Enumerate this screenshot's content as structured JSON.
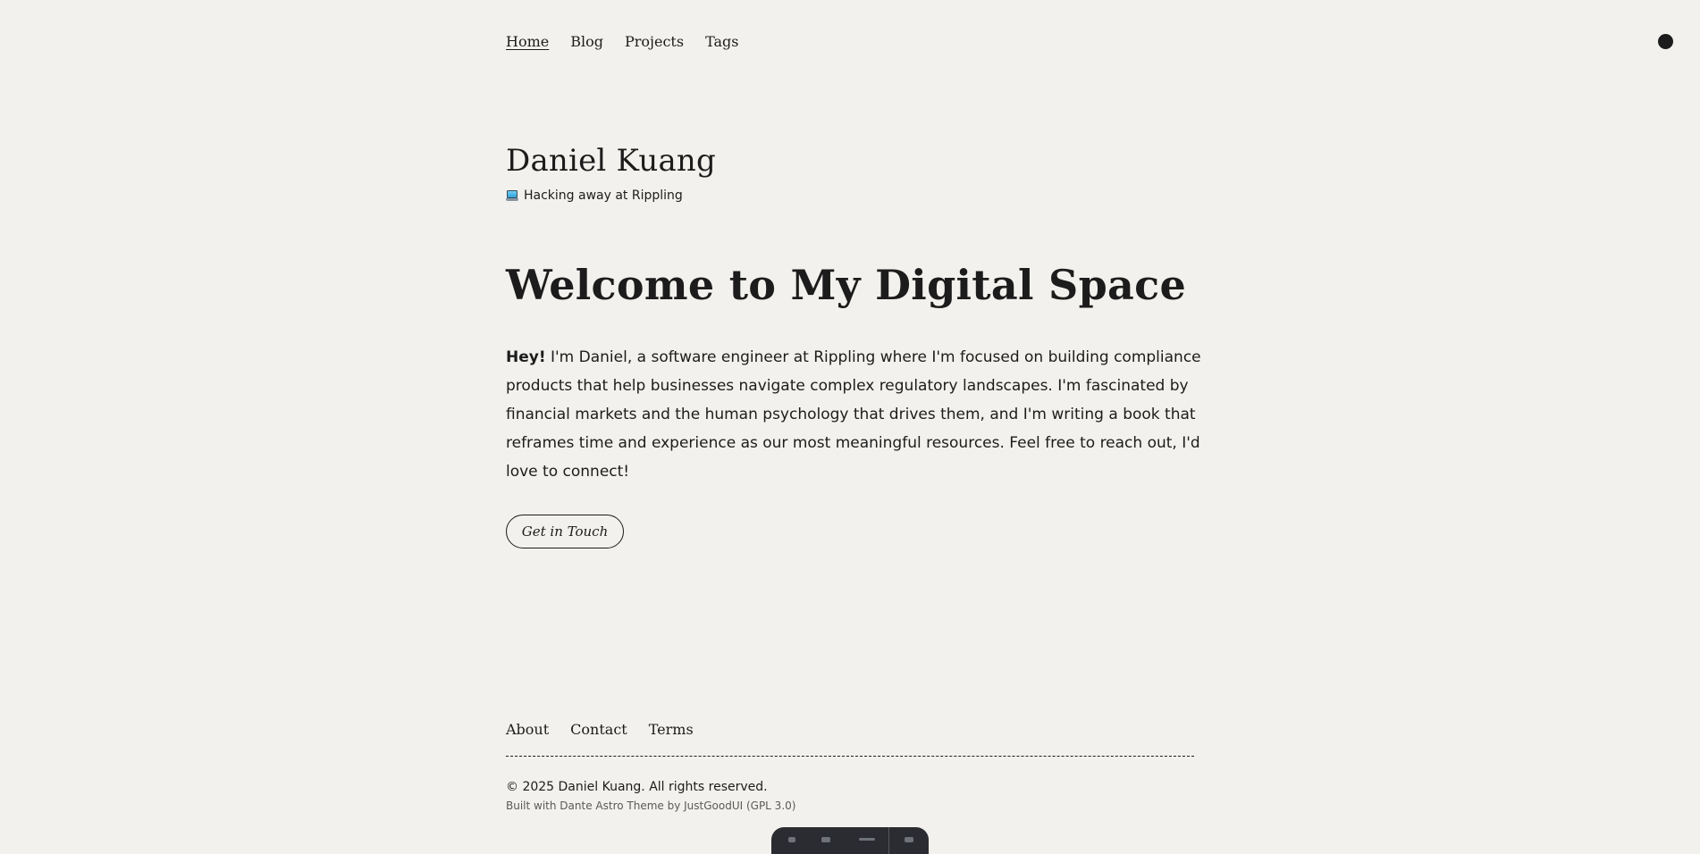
{
  "nav": {
    "items": [
      {
        "label": "Home",
        "active": true
      },
      {
        "label": "Blog",
        "active": false
      },
      {
        "label": "Projects",
        "active": false
      },
      {
        "label": "Tags",
        "active": false
      }
    ],
    "theme_toggle_icon": "dark-mode-dot-icon"
  },
  "header": {
    "site_name": "Daniel Kuang",
    "tagline_icon": "laptop-icon",
    "tagline": "Hacking away at Rippling"
  },
  "hero": {
    "title": "Welcome to My Digital Space",
    "intro_lead": "Hey!",
    "intro_body": " I'm Daniel, a software engineer at Rippling where I'm focused on building compliance products that help businesses navigate complex regulatory landscapes. I'm fascinated by financial markets and the human psychology that drives them, and I'm writing a book that reframes time and experience as our most meaningful resources. Feel free to reach out, I'd love to connect!",
    "cta_label": "Get in Touch"
  },
  "footer": {
    "links": [
      {
        "label": "About"
      },
      {
        "label": "Contact"
      },
      {
        "label": "Terms"
      }
    ],
    "copyright": "© 2025 Daniel Kuang. All rights reserved.",
    "credits": "Built with Dante Astro Theme by JustGoodUI (GPL 3.0)"
  },
  "colors": {
    "background": "#f2f1ed",
    "text": "#1c1c1c",
    "muted": "#5a5a5a",
    "dock": "#2a2c31"
  }
}
